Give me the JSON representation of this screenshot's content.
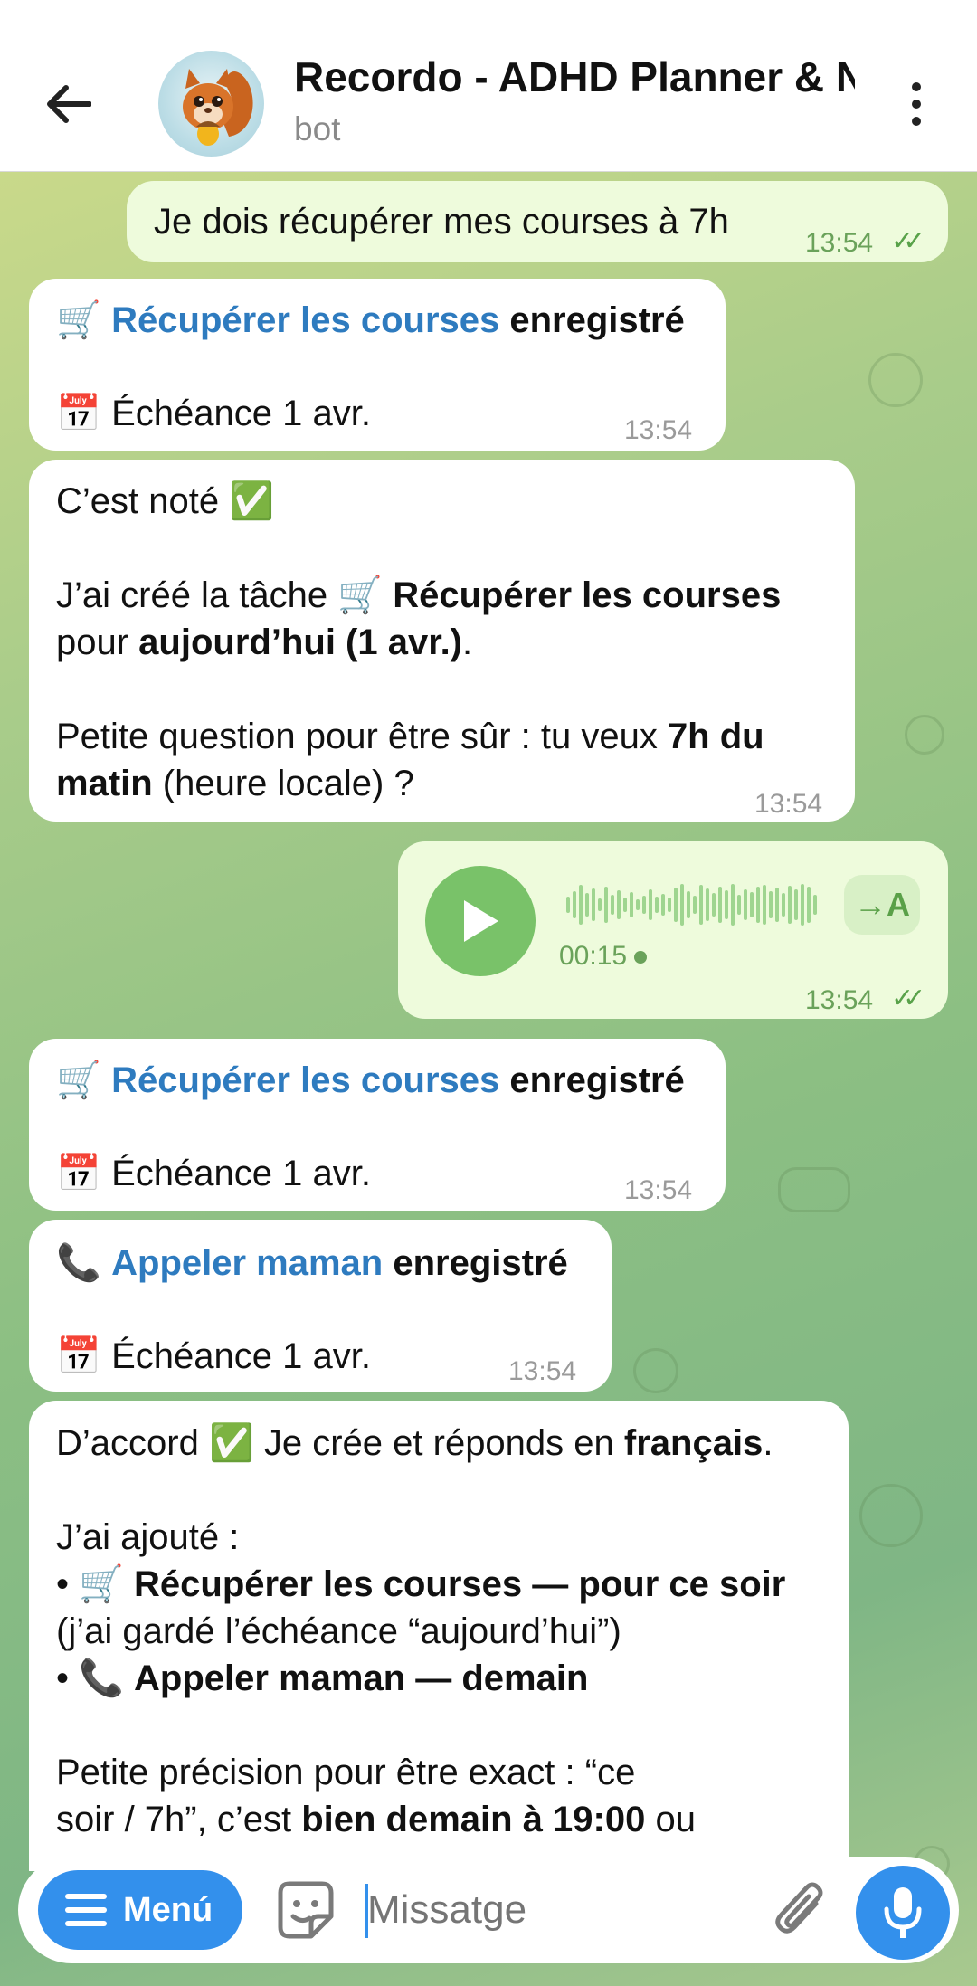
{
  "header": {
    "title": "Recordo - ADHD Planner & N",
    "subtitle": "bot",
    "back_icon": "arrow-left-icon",
    "menu_icon": "more-vertical-icon"
  },
  "messages": {
    "m1": {
      "text": "Je dois récupérer mes courses à 7h",
      "time": "13:54",
      "status": "✓✓"
    },
    "m2": {
      "emoji": "🛒",
      "link": "Récupérer les courses",
      "suffix": " enregistré",
      "due_emoji": "📅",
      "due": "Échéance 1 avr.",
      "time": "13:54"
    },
    "m3": {
      "line1": "C’est noté ✅",
      "l2a": "J’ai créé la tâche 🛒 ",
      "l2b": "Récupérer les courses",
      "l3a": "pour ",
      "l3b": "aujourd’hui (1 avr.)",
      "l3c": ".",
      "l4a": "Petite question pour être sûr : tu veux ",
      "l4b": "7h du",
      "l5a": "matin",
      "l5b": " (heure locale) ?",
      "time": "13:54"
    },
    "m4": {
      "duration": "00:15",
      "transcribe": "→A",
      "time": "13:54",
      "status": "✓✓"
    },
    "m5": {
      "emoji": "🛒",
      "link": "Récupérer les courses",
      "suffix": " enregistré",
      "due_emoji": "📅",
      "due": "Échéance 1 avr.",
      "time": "13:54"
    },
    "m6": {
      "emoji": "📞",
      "link": "Appeler maman",
      "suffix": " enregistré",
      "due_emoji": "📅",
      "due": "Échéance 1 avr.",
      "time": "13:54"
    },
    "m7": {
      "l1a": "D’accord ✅ Je crée et réponds en ",
      "l1b": "français",
      "l1c": ".",
      "l2": "J’ai ajouté :",
      "l3a": "• 🛒 ",
      "l3b": "Récupérer les courses — pour ce soir",
      "l4": "(j’ai gardé l’échéance “aujourd’hui”)",
      "l5a": "• 📞 ",
      "l5b": "Appeler maman — demain",
      "l6": "Petite précision pour être exact : “ce",
      "l7a": "soir / 7h”, c’est ",
      "l7b": "bien demain à 19:00",
      "l7c": " ou"
    }
  },
  "input": {
    "menu_label": "Menú",
    "placeholder": "Missatge"
  },
  "colors": {
    "accent": "#3390ec",
    "link": "#2e7bbf",
    "outgoing_bubble": "#eefbdc",
    "incoming_bubble": "#ffffff"
  }
}
